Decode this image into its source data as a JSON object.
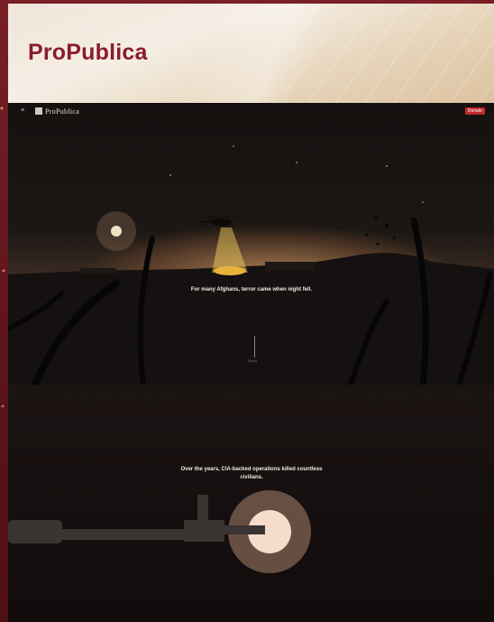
{
  "header": {
    "title": "ProPublica"
  },
  "site": {
    "logo_text": "ProPublica",
    "donate_label": "Donate",
    "menu_icon": "menu-icon"
  },
  "story": {
    "caption_1": "For many Afghans, terror came when night fell.",
    "caption_2": "Over the years, CIA-backed operations killed countless civilians.",
    "scroll_label": "Scroll"
  },
  "colors": {
    "frame": "#6b1a22",
    "brand": "#8a1c2b",
    "donate": "#c0272d"
  }
}
